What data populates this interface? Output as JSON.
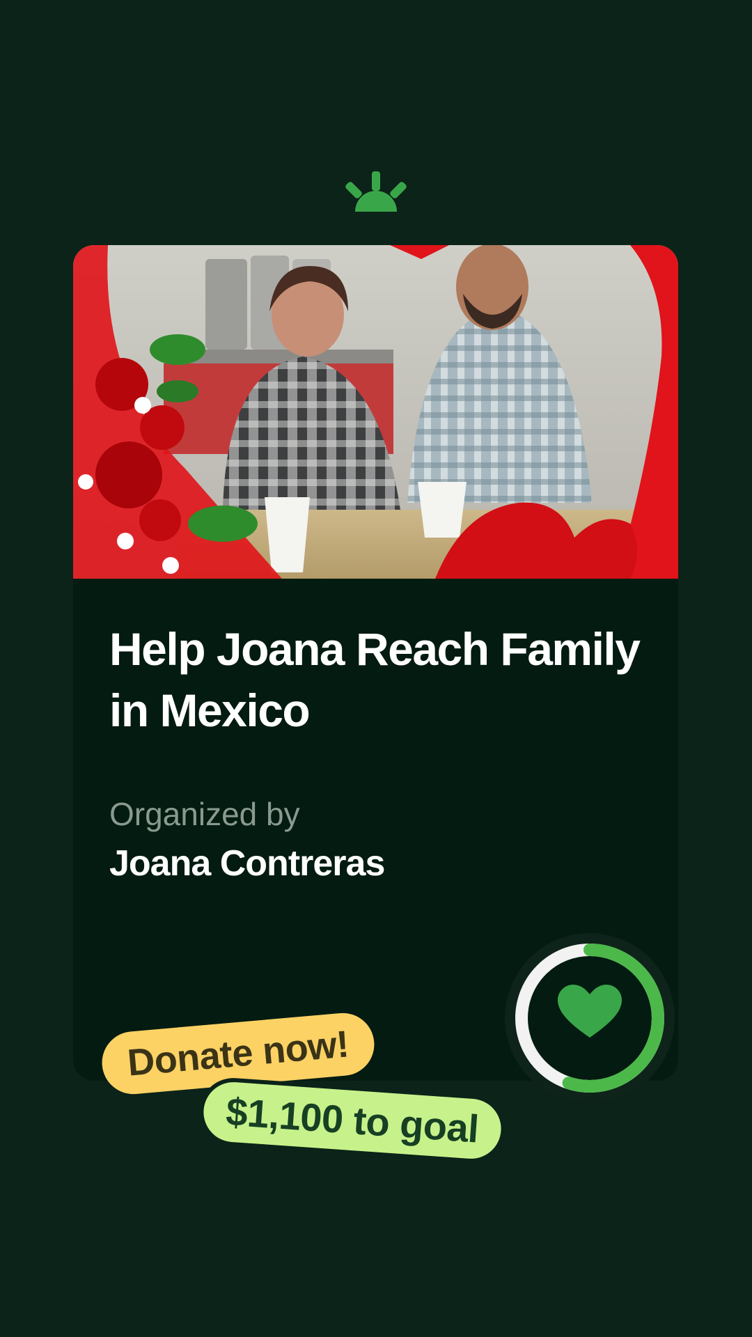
{
  "campaign": {
    "title": "Help Joana Reach Family in Mexico",
    "organizer_label": "Organized by",
    "organizer_name": "Joana Contreras",
    "photo_alt": "Photo of a smiling couple seated at a table"
  },
  "actions": {
    "donate_label": "Donate now!"
  },
  "goal": {
    "remaining_label": "$1,100 to goal",
    "progress_fraction": 0.55
  },
  "icons": {
    "brand": "gofundme-sun-icon",
    "progress_center": "heart-icon"
  },
  "colors": {
    "background": "#0b2318",
    "card": "#031b10",
    "brand_green": "#3aa64a",
    "progress_light": "#9be25f",
    "progress_track": "#f1f2f1",
    "donate_pill": "#fcd265",
    "goal_pill": "#c7f28b"
  }
}
